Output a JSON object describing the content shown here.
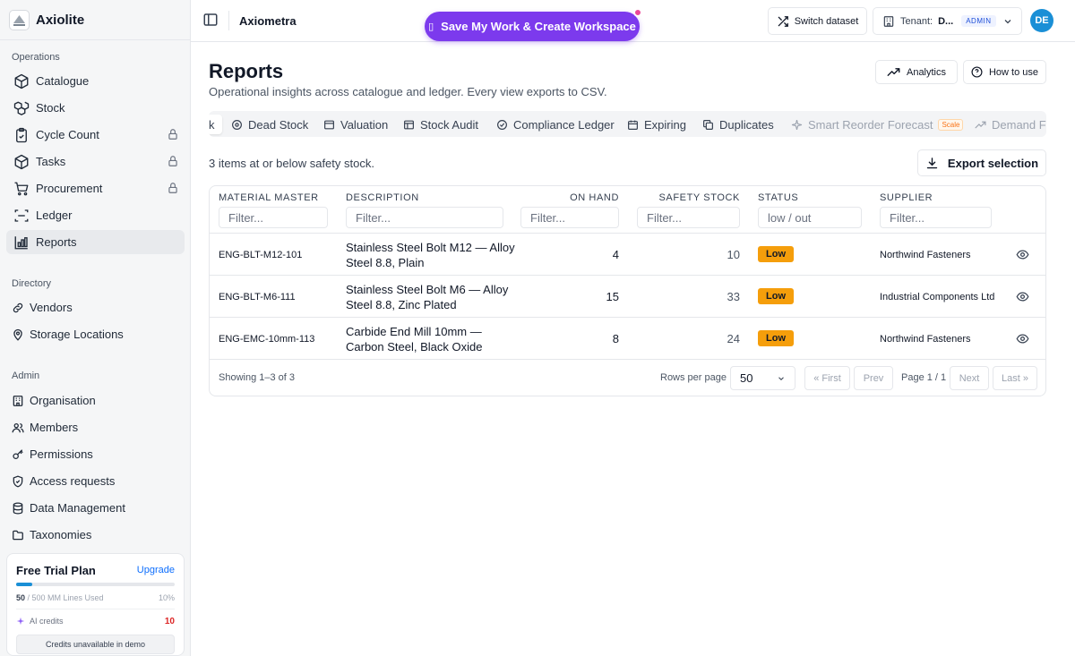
{
  "brand": {
    "name": "Axiolite"
  },
  "sidebar": {
    "sections": {
      "operations": "Operations",
      "directory": "Directory",
      "admin": "Admin"
    },
    "operations": [
      {
        "label": "Catalogue",
        "icon": "box-icon",
        "locked": false
      },
      {
        "label": "Stock",
        "icon": "boxes-icon",
        "locked": false
      },
      {
        "label": "Cycle Count",
        "icon": "clipboard-check-icon",
        "locked": true
      },
      {
        "label": "Tasks",
        "icon": "box-icon",
        "locked": true
      },
      {
        "label": "Procurement",
        "icon": "cart-icon",
        "locked": true
      },
      {
        "label": "Ledger",
        "icon": "scan-icon",
        "locked": false
      },
      {
        "label": "Reports",
        "icon": "chart-icon",
        "locked": false,
        "active": true
      }
    ],
    "directory": [
      {
        "label": "Vendors",
        "icon": "link-icon"
      },
      {
        "label": "Storage Locations",
        "icon": "map-pin-icon"
      }
    ],
    "admin": [
      {
        "label": "Organisation",
        "icon": "building-icon"
      },
      {
        "label": "Members",
        "icon": "users-icon"
      },
      {
        "label": "Permissions",
        "icon": "key-icon"
      },
      {
        "label": "Access requests",
        "icon": "shield-icon"
      },
      {
        "label": "Data Management",
        "icon": "database-icon"
      },
      {
        "label": "Taxonomies",
        "icon": "folder-icon"
      }
    ],
    "trial": {
      "title": "Free Trial Plan",
      "upgrade": "Upgrade",
      "used": "50",
      "limit": " / 500 MM Lines Used",
      "percent": "10%",
      "percent_value": 10,
      "ai_label": "AI credits",
      "ai_count": "10",
      "credits_button": "Credits unavailable in demo"
    }
  },
  "topbar": {
    "breadcrumb": "Axiometra",
    "save_button": "Save My Work & Create Workspace",
    "switch_dataset": "Switch dataset",
    "tenant_label": "Tenant:",
    "tenant_value": "D...",
    "role_badge": "ADMIN",
    "avatar_initials": "DE"
  },
  "page": {
    "title": "Reports",
    "subtitle": "Operational insights across catalogue and ledger. Every view exports to CSV.",
    "analytics_button": "Analytics",
    "how_to_button": "How to use"
  },
  "tabs": [
    {
      "label": "k",
      "active": true
    },
    {
      "label": "Dead Stock",
      "icon": "alert-circle-icon"
    },
    {
      "label": "Valuation",
      "icon": "tag-icon"
    },
    {
      "label": "Stock Audit",
      "icon": "audit-icon"
    },
    {
      "label": "Compliance Ledger",
      "icon": "shield-check-icon"
    },
    {
      "label": "Expiring",
      "icon": "calendar-icon"
    },
    {
      "label": "Duplicates",
      "icon": "copy-icon"
    },
    {
      "label": "Smart Reorder Forecast",
      "icon": "sparkle-icon",
      "disabled": true,
      "badge": "Scale"
    },
    {
      "label": "Demand Fo",
      "icon": "trend-icon",
      "disabled": true
    }
  ],
  "summary": "3 items at or below safety stock.",
  "export_button": "Export selection",
  "table": {
    "columns": {
      "material_master": "MATERIAL MASTER",
      "description": "DESCRIPTION",
      "on_hand": "ON HAND",
      "safety_stock": "SAFETY STOCK",
      "status": "STATUS",
      "supplier": "SUPPLIER"
    },
    "filters": {
      "material_master": "Filter...",
      "description": "Filter...",
      "on_hand": "Filter...",
      "safety_stock": "Filter...",
      "status": "low / out",
      "supplier": "Filter..."
    },
    "rows": [
      {
        "mm": "ENG-BLT-M12-101",
        "desc": "Stainless Steel Bolt M12 — Alloy Steel 8.8, Plain",
        "on_hand": "4",
        "safety": "10",
        "status": "Low",
        "supplier": "Northwind Fasteners"
      },
      {
        "mm": "ENG-BLT-M6-111",
        "desc": "Stainless Steel Bolt M6 — Alloy Steel 8.8, Zinc Plated",
        "on_hand": "15",
        "safety": "33",
        "status": "Low",
        "supplier": "Industrial Components Ltd"
      },
      {
        "mm": "ENG-EMC-10mm-113",
        "desc": "Carbide End Mill 10mm — Carbon Steel, Black Oxide",
        "on_hand": "8",
        "safety": "24",
        "status": "Low",
        "supplier": "Northwind Fasteners"
      }
    ],
    "footer": {
      "showing": "Showing 1–3 of 3",
      "rows_per_page_label": "Rows per page",
      "rows_per_page": "50",
      "first": "« First",
      "prev": "Prev",
      "page": "Page 1 / 1",
      "next": "Next",
      "last": "Last »"
    }
  },
  "colors": {
    "accent_purple": "#7c3aed",
    "notify_pink": "#ec4899",
    "avatar_blue": "#1a8fd6",
    "low_badge": "#f59e0b",
    "upgrade_link": "#0d6efd",
    "ai_count": "#dc2626"
  }
}
